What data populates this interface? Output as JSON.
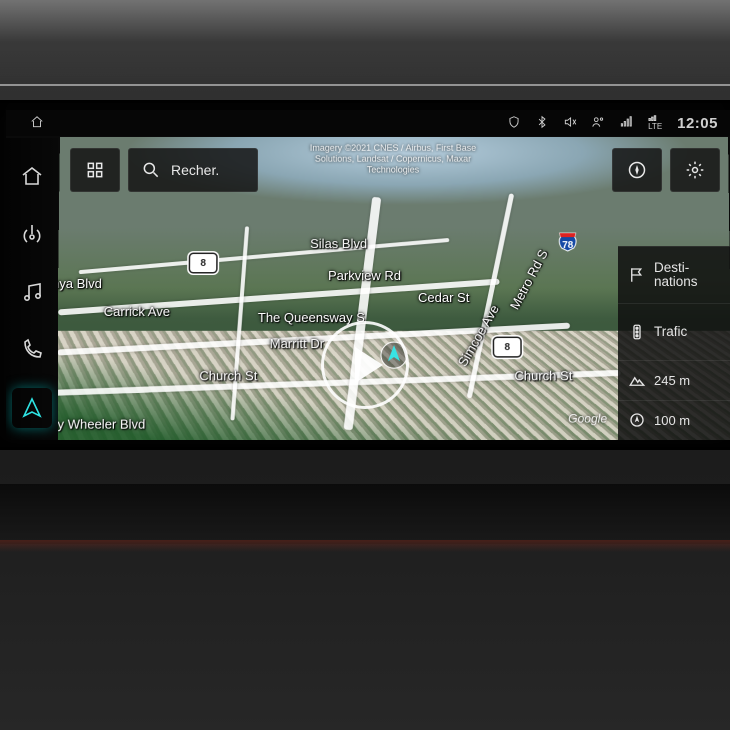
{
  "statusbar": {
    "time": "12:05",
    "lte_label": "LTE"
  },
  "toolbar": {
    "search_label": "Recher."
  },
  "attribution": {
    "line1": "Imagery ©2021 CNES / Airbus, First Base",
    "line2": "Solutions, Landsat / Copernicus, Maxar",
    "line3": "Technologies"
  },
  "attribution_br": "Google",
  "streets": {
    "silas": "Silas Blvd",
    "parkview": "Parkview Rd",
    "cedar": "Cedar St",
    "metro": "Metro Rd S",
    "queensway": "The Queensway S",
    "simcoe": "Simcoe Ave",
    "marritt": "Marritt Dr",
    "church_l": "Church St",
    "church_r": "Church St",
    "carrick": "Carrick Ave",
    "nya": "nya Blvd",
    "wheeler": "ny Wheeler Blvd"
  },
  "shields": {
    "hwy78": "78",
    "route_w": "8"
  },
  "rightpanel": {
    "destinations": "Desti-\nnations",
    "traffic": "Trafic",
    "altitude_value": "245 m",
    "range_value": "100 m"
  }
}
